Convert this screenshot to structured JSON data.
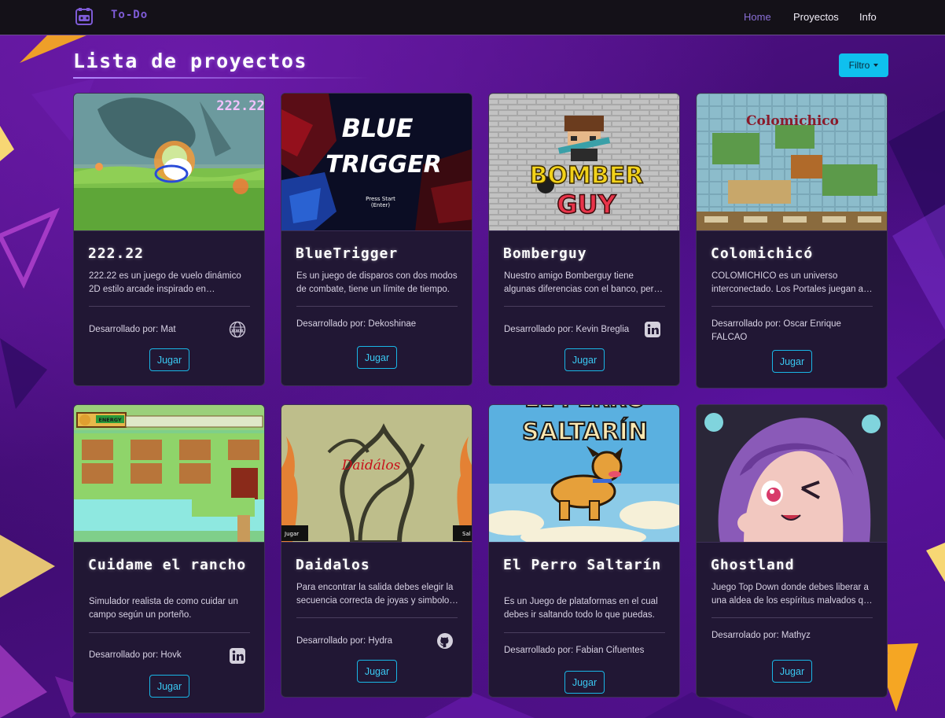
{
  "navbar": {
    "brand": "To-Do",
    "links": [
      {
        "label": "Home",
        "active": true
      },
      {
        "label": "Proyectos",
        "active": false
      },
      {
        "label": "Info",
        "active": false
      }
    ]
  },
  "header": {
    "title": "Lista de proyectos",
    "filter_label": "Filtro"
  },
  "colors": {
    "accent": "#0fc0ee",
    "card_bg": "#211734",
    "nav_bg": "#141118",
    "brand": "#7e5bd6"
  },
  "cards": [
    {
      "title": "222.22",
      "image_text": "222.22",
      "description": "222.22 es un juego de vuelo dinámico 2D estilo arcade inspirado en FREEDOM PLANET.",
      "developer": "Desarrollado por: Mat",
      "link_icon": "globe-icon",
      "play_label": "Jugar"
    },
    {
      "title": "BlueTrigger",
      "image_text": [
        "BLUE",
        "TRIGGER",
        "Press Start",
        "(Enter)"
      ],
      "description": "Es un juego de disparos con dos modos de combate, tiene un límite de tiempo.",
      "developer": "Desarrollado por: Dekoshinae",
      "link_icon": "",
      "play_label": "Jugar"
    },
    {
      "title": "Bomberguy",
      "image_text": [
        "BOMBER",
        "GUY"
      ],
      "description": "Nuestro amigo Bomberguy tiene algunas diferencias con el banco, pero decide resolverlas a su manera.",
      "developer": "Desarrollado por: Kevin Breglia",
      "link_icon": "linkedin-icon",
      "play_label": "Jugar"
    },
    {
      "title": "Colomichicó",
      "image_text": "Colomichico",
      "description": "COLOMICHICO es un universo interconectado. Los Portales juegan a tu favor.",
      "developer": "Desarrollado por: Oscar Enrique FALCAO",
      "link_icon": "",
      "play_label": "Jugar"
    },
    {
      "title": "Cuidame el rancho",
      "image_text": "ENERGY",
      "description": "Simulador realista de como cuidar un campo según un porteño.",
      "developer": "Desarrollado por: Hovk",
      "link_icon": "linkedin-icon",
      "play_label": "Jugar"
    },
    {
      "title": "Daidalos",
      "image_text": [
        "Daidálos",
        "Jugar",
        "Sal"
      ],
      "description": "Para encontrar la salida debes elegir la secuencia correcta de joyas y simbolos antes de que el tiempo termine.",
      "developer": "Desarrollado por: Hydra",
      "link_icon": "github-icon",
      "play_label": "Jugar"
    },
    {
      "title": "El Perro Saltarín",
      "image_text": [
        "EL PERRO",
        "SALTARÍN"
      ],
      "description": "Es un Juego de plataformas en el cual debes ir saltando todo lo que puedas.",
      "developer": "Desarrollado por: Fabian Cifuentes",
      "link_icon": "",
      "play_label": "Jugar"
    },
    {
      "title": "Ghostland",
      "image_text": "",
      "description": "Juego Top Down donde debes liberar a una aldea de los espíritus malvados que la atormentan.",
      "developer": "Desarrolado por: Mathyz",
      "link_icon": "",
      "play_label": "Jugar"
    }
  ]
}
